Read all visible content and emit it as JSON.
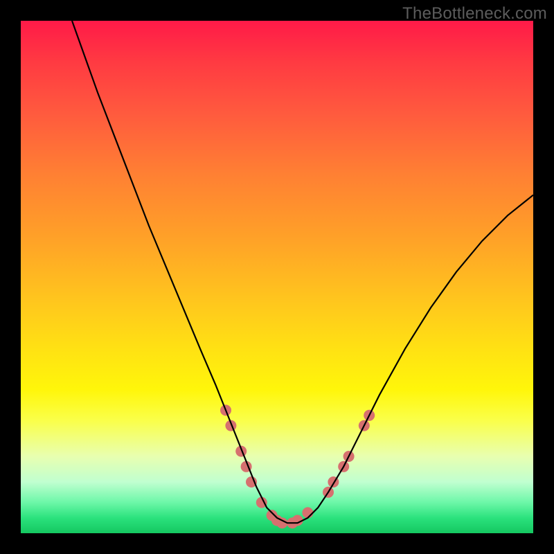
{
  "watermark": "TheBottleneck.com",
  "chart_data": {
    "type": "line",
    "title": "",
    "xlabel": "",
    "ylabel": "",
    "xlim": [
      0,
      100
    ],
    "ylim": [
      0,
      100
    ],
    "grid": false,
    "series": [
      {
        "name": "curve",
        "color": "#000000",
        "x": [
          10,
          15,
          20,
          25,
          30,
          35,
          38,
          40,
          42,
          44,
          46,
          48,
          50,
          52,
          54,
          56,
          58,
          60,
          63,
          66,
          70,
          75,
          80,
          85,
          90,
          95,
          100
        ],
        "y": [
          100,
          86,
          73,
          60,
          48,
          36,
          29,
          24,
          19,
          14,
          9,
          5,
          3,
          2,
          2,
          3,
          5,
          8,
          13,
          19,
          27,
          36,
          44,
          51,
          57,
          62,
          66
        ]
      }
    ],
    "markers": {
      "name": "highlight-dots",
      "color": "#d6706f",
      "radius": 8,
      "points": [
        {
          "x": 40,
          "y": 24
        },
        {
          "x": 41,
          "y": 21
        },
        {
          "x": 43,
          "y": 16
        },
        {
          "x": 44,
          "y": 13
        },
        {
          "x": 45,
          "y": 10
        },
        {
          "x": 47,
          "y": 6
        },
        {
          "x": 49,
          "y": 3.5
        },
        {
          "x": 50,
          "y": 2.5
        },
        {
          "x": 51,
          "y": 2
        },
        {
          "x": 53,
          "y": 2
        },
        {
          "x": 54,
          "y": 2.5
        },
        {
          "x": 56,
          "y": 4
        },
        {
          "x": 60,
          "y": 8
        },
        {
          "x": 61,
          "y": 10
        },
        {
          "x": 63,
          "y": 13
        },
        {
          "x": 64,
          "y": 15
        },
        {
          "x": 67,
          "y": 21
        },
        {
          "x": 68,
          "y": 23
        }
      ]
    }
  }
}
